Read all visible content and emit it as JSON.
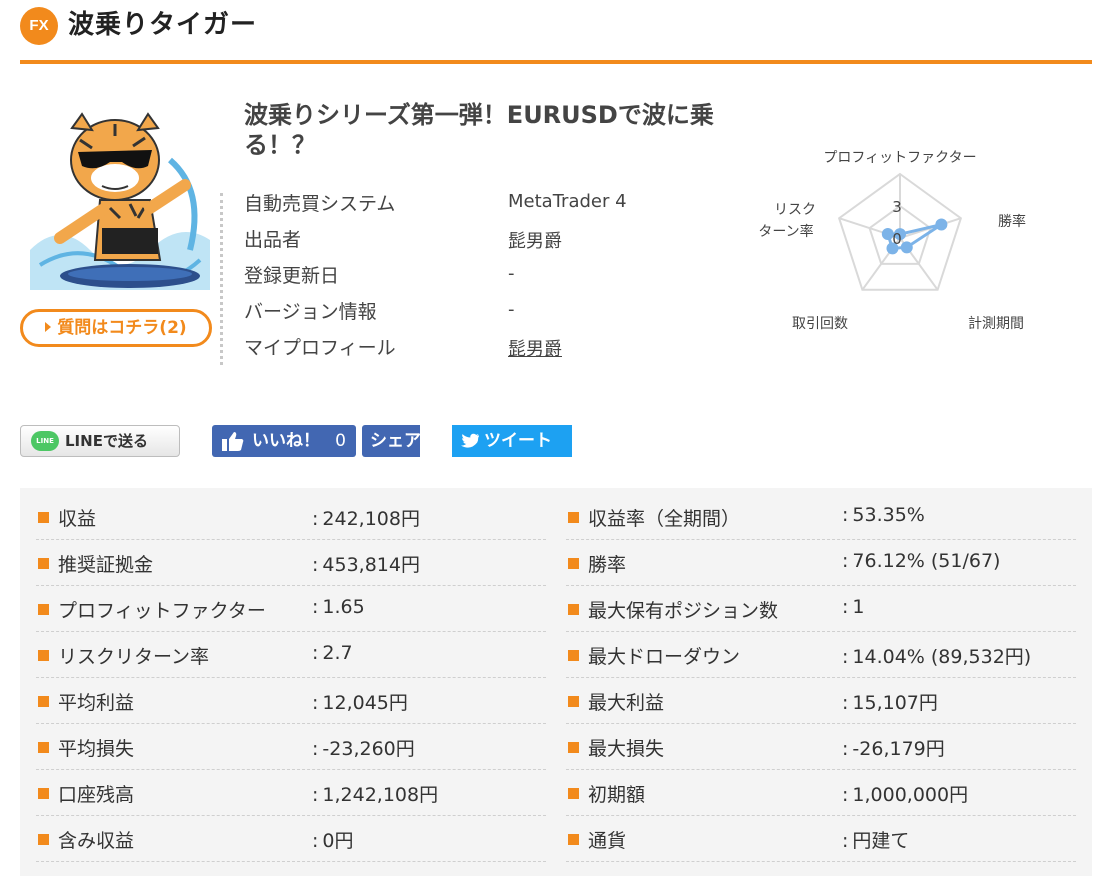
{
  "header": {
    "badge": "FX",
    "title": "波乗りタイガー"
  },
  "product": {
    "heading": "波乗りシリーズ第一弾！EURUSDで波に乗る！？",
    "question_button": "質問はコチラ(2)",
    "info": [
      {
        "label": "自動売買システム",
        "value": "MetaTrader 4"
      },
      {
        "label": "出品者",
        "value": "髭男爵"
      },
      {
        "label": "登録更新日",
        "value": "-"
      },
      {
        "label": "バージョン情報",
        "value": "-"
      },
      {
        "label": "マイプロフィール",
        "value": "髭男爵"
      }
    ]
  },
  "chart_data": {
    "type": "radar",
    "axes": [
      "プロフィットファクター",
      "勝率",
      "計測期間",
      "取引回数",
      "リスクリターン率"
    ],
    "axis_labels_display": [
      "プロフィットファクター",
      "勝率",
      "計測期間",
      "取引回数",
      "リスク",
      "ターン率"
    ],
    "scale_labels": [
      "3",
      "0"
    ],
    "range": [
      0,
      5
    ],
    "values": [
      0.3,
      3.4,
      0.9,
      1.0,
      1.0
    ],
    "colors": {
      "series": "#7cb3e8",
      "grid": "#d9d9d9"
    }
  },
  "social": {
    "line": {
      "label": "LINEで送る",
      "icon_text": "LINE"
    },
    "fb_like": {
      "label": "いいね！",
      "count": "0"
    },
    "fb_share": {
      "label": "シェア"
    },
    "tweet": {
      "label": "ツイート"
    }
  },
  "stats": {
    "left": [
      {
        "label": "収益",
        "value": "242,108円"
      },
      {
        "label": "推奨証拠金",
        "value": "453,814円"
      },
      {
        "label": "プロフィットファクター",
        "value": "1.65"
      },
      {
        "label": "リスクリターン率",
        "value": "2.7"
      },
      {
        "label": "平均利益",
        "value": "12,045円"
      },
      {
        "label": "平均損失",
        "value": "-23,260円"
      },
      {
        "label": "口座残高",
        "value": "1,242,108円"
      },
      {
        "label": "含み収益",
        "value": "0円"
      }
    ],
    "right": [
      {
        "label": "収益率（全期間）",
        "value": "53.35%"
      },
      {
        "label": "勝率",
        "value": "76.12% (51/67)"
      },
      {
        "label": "最大保有ポジション数",
        "value": "1"
      },
      {
        "label": "最大ドローダウン",
        "value": "14.04% (89,532円)"
      },
      {
        "label": "最大利益",
        "value": "15,107円"
      },
      {
        "label": "最大損失",
        "value": "-26,179円"
      },
      {
        "label": "初期額",
        "value": "1,000,000円"
      },
      {
        "label": "通貨",
        "value": "円建て"
      }
    ]
  },
  "colors": {
    "accent": "#f28a1c",
    "facebook": "#4267b2",
    "twitter": "#1da1f2",
    "line": "#4cc764"
  }
}
